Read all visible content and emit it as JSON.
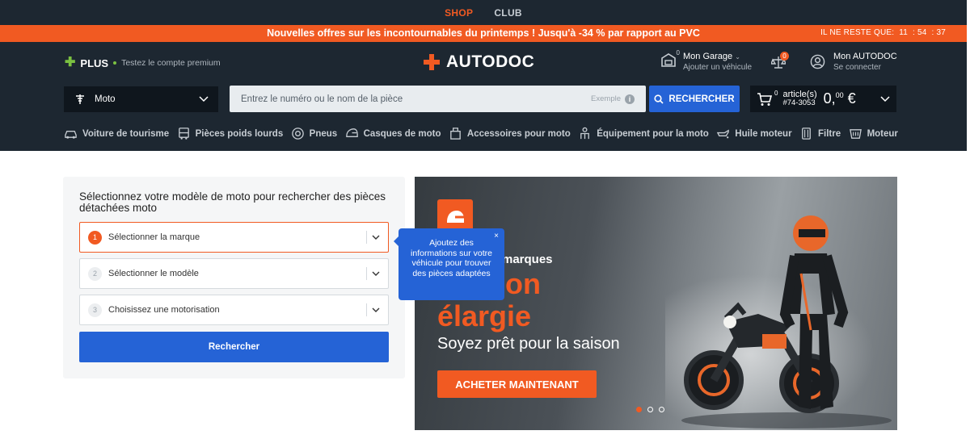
{
  "topbar": {
    "shop": "SHOP",
    "club": "CLUB"
  },
  "promo": {
    "message": "Nouvelles offres sur les incontournables du printemps ! Jusqu'à -34 % par rapport au PVC",
    "timer_label": "IL NE RESTE QUE:",
    "hours": "11",
    "minutes": ": 54",
    "seconds": ": 37"
  },
  "header": {
    "plus_label": "PLUS",
    "plus_sub": "Testez le compte premium",
    "logo": "AUTODOC",
    "garage_title": "Mon Garage",
    "garage_sub": "Ajouter un véhicule",
    "garage_count": "0",
    "compare_count": "0",
    "account_title": "Mon AUTODOC",
    "account_sub": "Se connecter"
  },
  "search": {
    "vehicle_type": "Moto",
    "placeholder": "Entrez le numéro ou le nom de la pièce",
    "example": "Exemple",
    "button": "RECHERCHER"
  },
  "cart": {
    "count": "0",
    "label": "article(s)",
    "ref": "#74-3053",
    "price_int": "0,",
    "price_dec": "00",
    "currency": "€"
  },
  "nav": [
    {
      "label": "Voiture de tourisme",
      "icon": "car-icon"
    },
    {
      "label": "Pièces poids lourds",
      "icon": "truck-icon"
    },
    {
      "label": "Pneus",
      "icon": "tire-icon"
    },
    {
      "label": "Casques de moto",
      "icon": "helmet-icon"
    },
    {
      "label": "Accessoires pour moto",
      "icon": "accessories-icon"
    },
    {
      "label": "Équipement pour la moto",
      "icon": "rider-icon"
    },
    {
      "label": "Huile moteur",
      "icon": "oil-icon"
    },
    {
      "label": "Filtre",
      "icon": "filter-icon"
    },
    {
      "label": "Moteur",
      "icon": "engine-icon"
    }
  ],
  "selector": {
    "title": "Sélectionnez votre modèle de moto pour rechercher des pièces détachées moto",
    "steps": [
      {
        "num": "1",
        "label": "Sélectionner la marque"
      },
      {
        "num": "2",
        "label": "Sélectionner le modèle"
      },
      {
        "num": "3",
        "label": "Choisissez une motorisation"
      }
    ],
    "button": "Rechercher"
  },
  "tooltip": {
    "text": "Ajoutez des informations sur votre véhicule pour trouver des pièces adaptées",
    "close": "×"
  },
  "banner": {
    "line1": "marques",
    "line2": "ction",
    "line3": "élargie",
    "line4": "Soyez prêt pour la saison",
    "cta": "ACHETER MAINTENANT",
    "slides": 3,
    "active_slide": 1
  },
  "colors": {
    "accent": "#f15a22",
    "primary": "#2563d6",
    "dark": "#1d2731"
  }
}
